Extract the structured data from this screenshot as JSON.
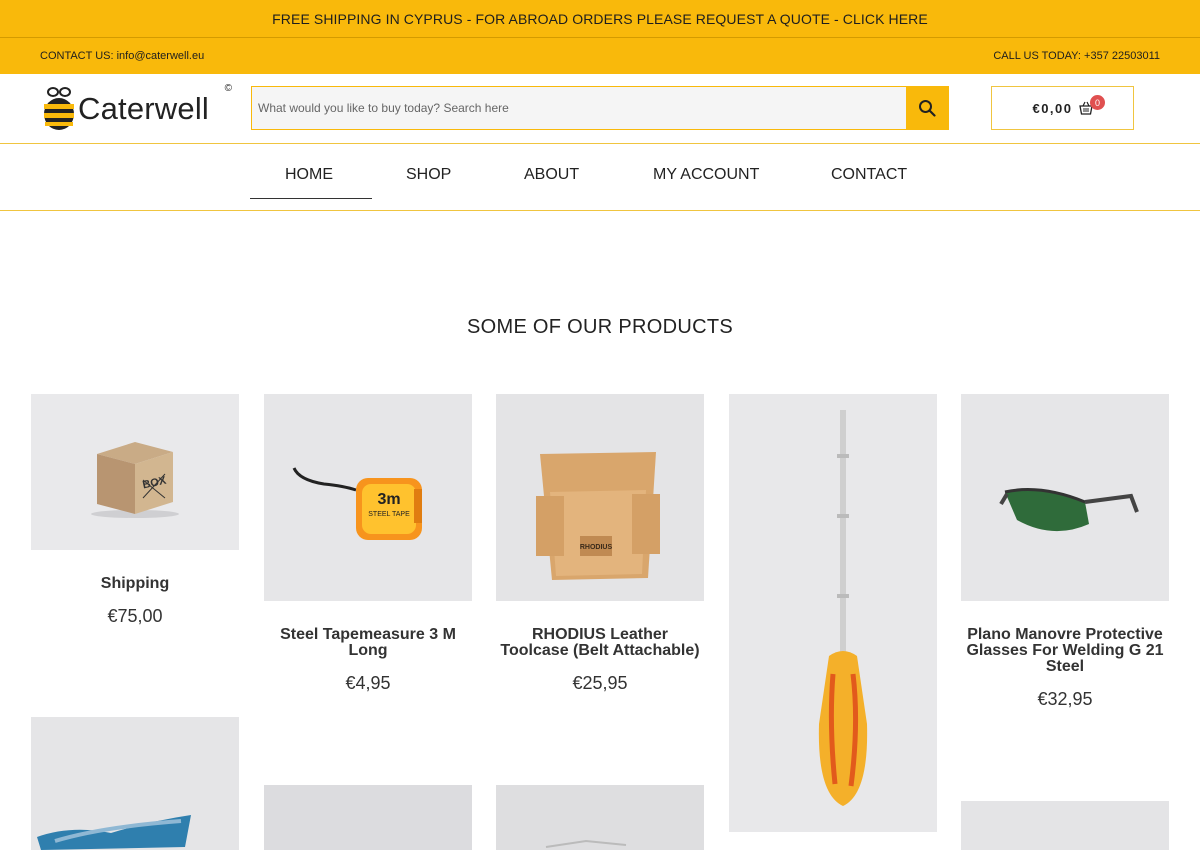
{
  "promo": {
    "text": "FREE SHIPPING IN CYPRUS - FOR ABROAD ORDERS PLEASE REQUEST A QUOTE - CLICK HERE"
  },
  "contact": {
    "email_text": "CONTACT US: info@caterwell.eu",
    "phone_text": "CALL US TODAY: +357 22503011"
  },
  "logo": {
    "wordmark": "Caterwell",
    "copyright": "©"
  },
  "search": {
    "placeholder": "What would you like to buy today? Search here",
    "icon": "search-icon"
  },
  "cart": {
    "total": "€0,00",
    "count": "0",
    "icon": "basket-icon"
  },
  "nav": {
    "items": [
      "HOME",
      "SHOP",
      "ABOUT",
      "MY ACCOUNT",
      "CONTACT"
    ],
    "active": "HOME"
  },
  "section": {
    "title": "SOME OF OUR PRODUCTS"
  },
  "products": [
    {
      "name": "Shipping",
      "price": "€75,00"
    },
    {
      "name": "Steel Tapemeasure 3 M Long",
      "price": "€4,95"
    },
    {
      "name": "RHODIUS Leather Toolcase (Belt Attachable)",
      "price": "€25,95"
    },
    {
      "name": "",
      "price": ""
    },
    {
      "name": "Plano Manovre Protective Glasses For Welding G 21 Steel",
      "price": "€32,95"
    }
  ],
  "product_labels": {
    "box": "BOX",
    "tape_big": "3m",
    "tape_small": "STEEL TAPE",
    "toolcase": "RHODIUS"
  },
  "colors": {
    "accent": "#f9b90b",
    "badge": "#e05050",
    "text": "#222222"
  }
}
